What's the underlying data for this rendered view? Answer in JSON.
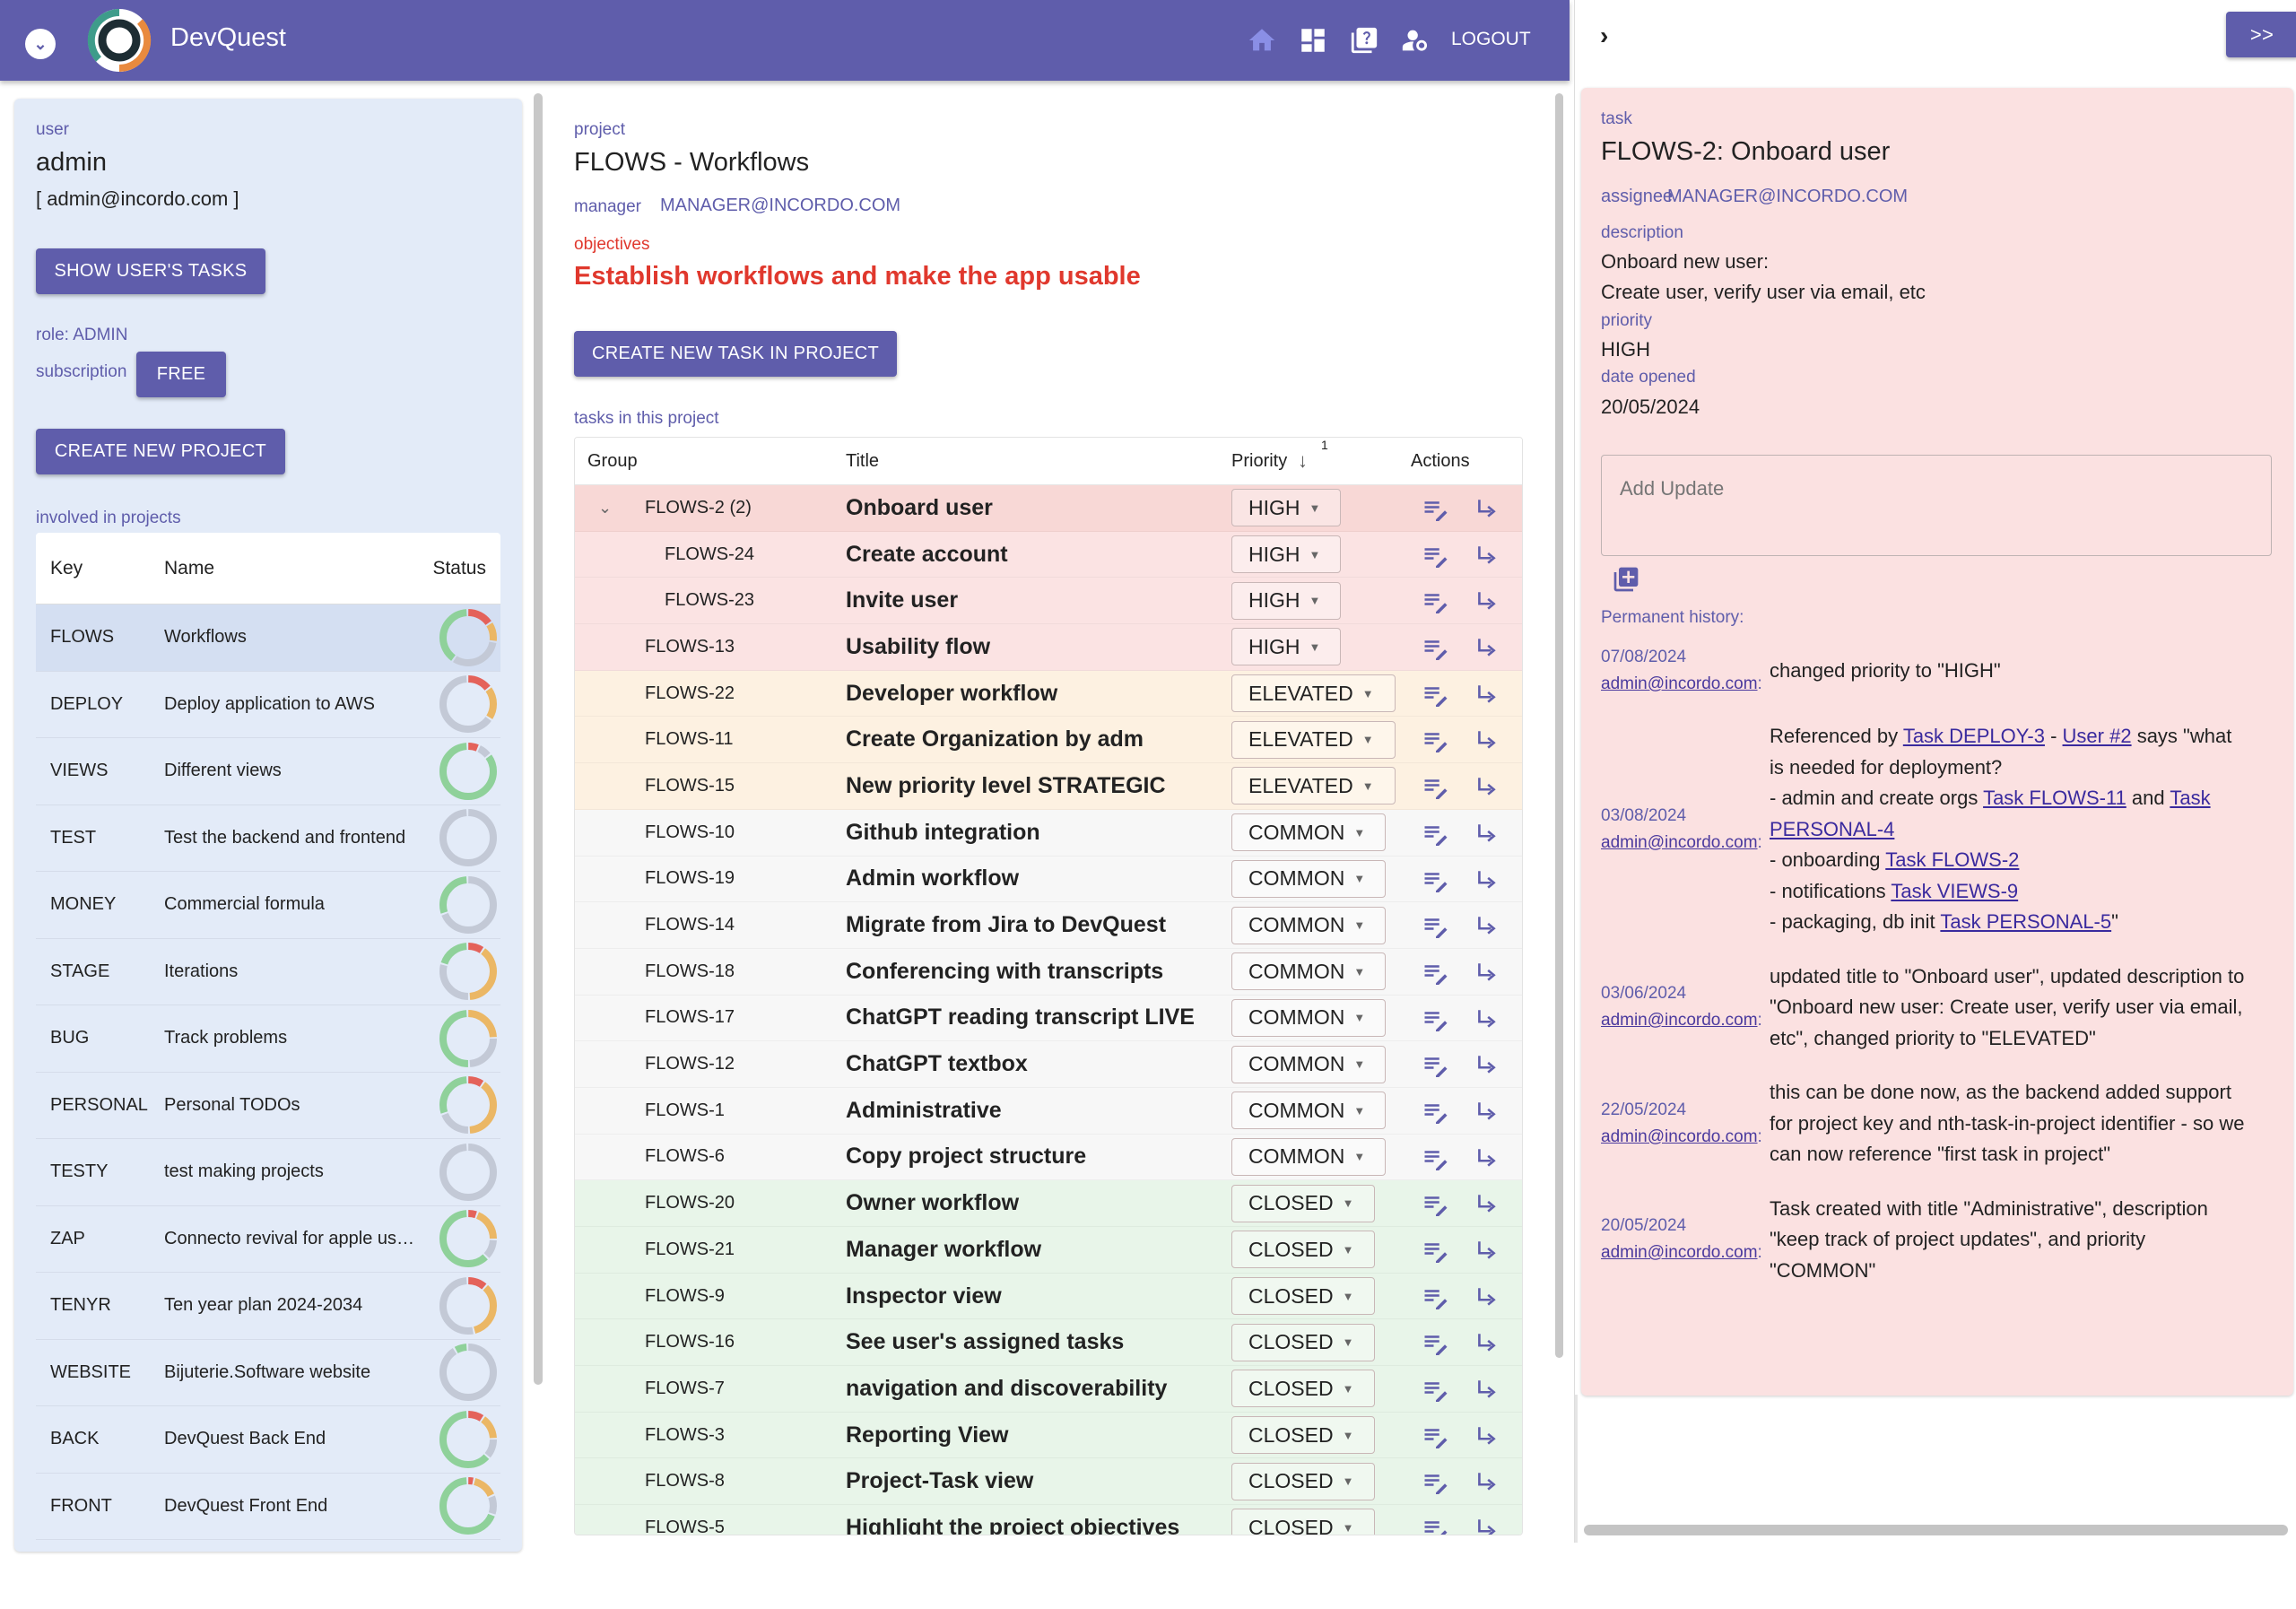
{
  "header": {
    "brand": "DevQuest",
    "logout": "LOGOUT",
    "accent": "#5f5dab",
    "icons": [
      "menu-chevron-icon",
      "home-icon",
      "dashboard-icon",
      "help-box-icon",
      "user-settings-icon"
    ]
  },
  "user": {
    "label": "user",
    "name": "admin",
    "email": "[ admin@incordo.com ]",
    "show_tasks": "SHOW USER'S TASKS",
    "role": "role: ADMIN",
    "subscription_label": "subscription",
    "subscription": "FREE",
    "create_project": "CREATE NEW PROJECT",
    "involved": "involved in projects"
  },
  "projects": {
    "headers": [
      "Key",
      "Name",
      "Status"
    ],
    "status_colors": {
      "high": "#e4625a",
      "elevated": "#ebb765",
      "common": "#c3c9d6",
      "closed": "#8fd19a"
    },
    "rows": [
      {
        "key": "FLOWS",
        "name": "Workflows",
        "status": {
          "high": 0.16,
          "elevated": 0.12,
          "common": 0.32,
          "closed": 0.4
        }
      },
      {
        "key": "DEPLOY",
        "name": "Deploy application to AWS",
        "status": {
          "high": 0.15,
          "elevated": 0.2,
          "common": 0.65,
          "closed": 0
        }
      },
      {
        "key": "VIEWS",
        "name": "Different views",
        "status": {
          "high": 0.07,
          "elevated": 0,
          "common": 0.08,
          "closed": 0.85
        }
      },
      {
        "key": "TEST",
        "name": "Test the backend and frontend",
        "status": {
          "high": 0,
          "elevated": 0,
          "common": 1,
          "closed": 0
        }
      },
      {
        "key": "MONEY",
        "name": "Commercial formula",
        "status": {
          "high": 0,
          "elevated": 0,
          "common": 0.7,
          "closed": 0.3
        }
      },
      {
        "key": "STAGE",
        "name": "Iterations",
        "status": {
          "high": 0.1,
          "elevated": 0.4,
          "common": 0.3,
          "closed": 0.2
        }
      },
      {
        "key": "BUG",
        "name": "Track problems",
        "status": {
          "high": 0,
          "elevated": 0.25,
          "common": 0.25,
          "closed": 0.5
        }
      },
      {
        "key": "PERSONAL",
        "name": "Personal TODOs",
        "status": {
          "high": 0.1,
          "elevated": 0.4,
          "common": 0.2,
          "closed": 0.3
        }
      },
      {
        "key": "TESTY",
        "name": "test making projects",
        "status": {
          "high": 0,
          "elevated": 0,
          "common": 1,
          "closed": 0
        }
      },
      {
        "key": "ZAP",
        "name": "Connecto revival for apple users",
        "status": {
          "high": 0.06,
          "elevated": 0.2,
          "common": 0.12,
          "closed": 0.62
        }
      },
      {
        "key": "TENYR",
        "name": "Ten year plan 2024-2034",
        "status": {
          "high": 0.12,
          "elevated": 0.35,
          "common": 0.53,
          "closed": 0
        }
      },
      {
        "key": "WEBSITE",
        "name": "Bijuterie.Software website",
        "status": {
          "high": 0,
          "elevated": 0,
          "common": 0.92,
          "closed": 0.08
        }
      },
      {
        "key": "BACK",
        "name": "DevQuest Back End",
        "status": {
          "high": 0.1,
          "elevated": 0.15,
          "common": 0.12,
          "closed": 0.63
        }
      },
      {
        "key": "FRONT",
        "name": "DevQuest Front End",
        "status": {
          "high": 0.04,
          "elevated": 0.15,
          "common": 0.12,
          "closed": 0.69
        }
      }
    ]
  },
  "project": {
    "label": "project",
    "title": "FLOWS - Workflows",
    "manager_label": "manager",
    "manager": "MANAGER@INCORDO.COM",
    "objectives_label": "objectives",
    "objectives": "Establish workflows and make the app usable",
    "create_task": "CREATE NEW TASK IN PROJECT",
    "tasks_label": "tasks in this project",
    "headers": {
      "group": "Group",
      "title": "Title",
      "priority": "Priority",
      "sort_index": "1",
      "actions": "Actions"
    },
    "row_colors": {
      "HIGH": "#fbe3e3",
      "ELEVATED": "#fdf1e1",
      "COMMON": "#f7f7f7",
      "CLOSED": "#e8f5e9"
    },
    "tasks": [
      {
        "group": "FLOWS-2 (2)",
        "title": "Onboard user",
        "priority": "HIGH",
        "expanded": true,
        "selected": true
      },
      {
        "group": "FLOWS-24",
        "title": "Create account",
        "priority": "HIGH",
        "child": true
      },
      {
        "group": "FLOWS-23",
        "title": "Invite user",
        "priority": "HIGH",
        "child": true
      },
      {
        "group": "FLOWS-13",
        "title": "Usability flow",
        "priority": "HIGH"
      },
      {
        "group": "FLOWS-22",
        "title": "Developer workflow",
        "priority": "ELEVATED"
      },
      {
        "group": "FLOWS-11",
        "title": "Create Organization by adm",
        "priority": "ELEVATED"
      },
      {
        "group": "FLOWS-15",
        "title": "New priority level STRATEGIC",
        "priority": "ELEVATED"
      },
      {
        "group": "FLOWS-10",
        "title": "Github integration",
        "priority": "COMMON"
      },
      {
        "group": "FLOWS-19",
        "title": "Admin workflow",
        "priority": "COMMON"
      },
      {
        "group": "FLOWS-14",
        "title": "Migrate from Jira to DevQuest",
        "priority": "COMMON"
      },
      {
        "group": "FLOWS-18",
        "title": "Conferencing with transcripts",
        "priority": "COMMON"
      },
      {
        "group": "FLOWS-17",
        "title": "ChatGPT reading transcript LIVE",
        "priority": "COMMON"
      },
      {
        "group": "FLOWS-12",
        "title": "ChatGPT textbox",
        "priority": "COMMON"
      },
      {
        "group": "FLOWS-1",
        "title": "Administrative",
        "priority": "COMMON"
      },
      {
        "group": "FLOWS-6",
        "title": "Copy project structure",
        "priority": "COMMON"
      },
      {
        "group": "FLOWS-20",
        "title": "Owner workflow",
        "priority": "CLOSED"
      },
      {
        "group": "FLOWS-21",
        "title": "Manager workflow",
        "priority": "CLOSED"
      },
      {
        "group": "FLOWS-9",
        "title": "Inspector view",
        "priority": "CLOSED"
      },
      {
        "group": "FLOWS-16",
        "title": "See user's assigned tasks",
        "priority": "CLOSED"
      },
      {
        "group": "FLOWS-7",
        "title": "navigation and discoverability",
        "priority": "CLOSED"
      },
      {
        "group": "FLOWS-3",
        "title": "Reporting View",
        "priority": "CLOSED"
      },
      {
        "group": "FLOWS-8",
        "title": "Project-Task view",
        "priority": "CLOSED"
      },
      {
        "group": "FLOWS-5",
        "title": "Highlight the project objectives",
        "priority": "CLOSED"
      }
    ]
  },
  "task": {
    "collapse_button": ">>",
    "label": "task",
    "title": "FLOWS-2: Onboard user",
    "assignee_label": "assignee",
    "assignee": "MANAGER@INCORDO.COM",
    "description_label": "description",
    "description": [
      "Onboard new user:",
      "Create user, verify user via email, etc"
    ],
    "priority_label": "priority",
    "priority": "HIGH",
    "date_label": "date opened",
    "date": "20/05/2024",
    "update_placeholder": "Add Update",
    "history_label": "Permanent history:",
    "history": [
      {
        "date": "07/08/2024",
        "user": "admin@incordo.com",
        "parts": [
          {
            "t": "changed priority to \"HIGH\""
          }
        ]
      },
      {
        "date": "03/08/2024",
        "user": "admin@incordo.com",
        "parts": [
          {
            "t": "Referenced by "
          },
          {
            "link": "Task DEPLOY-3"
          },
          {
            "t": " - "
          },
          {
            "link": "User #2"
          },
          {
            "t": " says \"what is needed for deployment? "
          },
          {
            "br": true
          },
          {
            "t": "- admin and create orgs "
          },
          {
            "link": "Task FLOWS-11"
          },
          {
            "t": " and "
          },
          {
            "link": "Task PERSONAL-4"
          },
          {
            "br": true
          },
          {
            "t": "- onboarding "
          },
          {
            "link": "Task FLOWS-2"
          },
          {
            "br": true
          },
          {
            "t": "- notifications "
          },
          {
            "link": "Task VIEWS-9"
          },
          {
            "br": true
          },
          {
            "t": "- packaging, db init "
          },
          {
            "link": "Task PERSONAL-5"
          },
          {
            "t": "\""
          }
        ]
      },
      {
        "date": "03/06/2024",
        "user": "admin@incordo.com",
        "parts": [
          {
            "t": "updated title to \"Onboard user\", updated description to \"Onboard new user: Create user, verify user via email, etc\", changed priority to \"ELEVATED\""
          }
        ]
      },
      {
        "date": "22/05/2024",
        "user": "admin@incordo.com",
        "parts": [
          {
            "t": "this can be done now, as the backend added support for project key and nth-task-in-project identifier - so we can now reference \"first task in project\""
          }
        ]
      },
      {
        "date": "20/05/2024",
        "user": "admin@incordo.com",
        "parts": [
          {
            "t": "Task created with title \"Administrative\", description \"keep track of project updates\", and priority \"COMMON\""
          }
        ]
      }
    ]
  }
}
